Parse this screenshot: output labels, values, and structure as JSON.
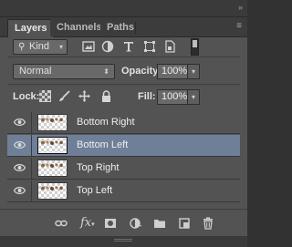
{
  "tabs": [
    {
      "label": "Layers",
      "active": true
    },
    {
      "label": "Channels",
      "active": false
    },
    {
      "label": "Paths",
      "active": false
    }
  ],
  "filter": {
    "kind_label": "Kind",
    "icons": [
      "pixel-layer-filter-icon",
      "adjustment-layer-filter-icon",
      "type-layer-filter-icon",
      "shape-layer-filter-icon",
      "smart-object-filter-icon"
    ]
  },
  "blend": {
    "mode": "Normal",
    "opacity_label": "Opacity:",
    "opacity_value": "100%"
  },
  "lock": {
    "label": "Lock:",
    "icons": [
      "lock-transparent-pixels-icon",
      "lock-image-pixels-icon",
      "lock-position-icon",
      "lock-all-icon"
    ],
    "fill_label": "Fill:",
    "fill_value": "100%"
  },
  "layers": [
    {
      "name": "Bottom Right",
      "visible": true,
      "selected": false
    },
    {
      "name": "Bottom Left",
      "visible": true,
      "selected": true
    },
    {
      "name": "Top Right",
      "visible": true,
      "selected": false
    },
    {
      "name": "Top Left",
      "visible": true,
      "selected": false
    }
  ],
  "toolbar": {
    "fx_label": "fx",
    "icons": [
      "link-layers-icon",
      "add-layer-style-icon",
      "add-layer-mask-icon",
      "new-adjustment-layer-icon",
      "new-group-icon",
      "new-layer-icon",
      "delete-layer-icon"
    ]
  },
  "colors": {
    "panel": "#535353",
    "selected_row": "#6f7f98",
    "field": "#696969"
  }
}
